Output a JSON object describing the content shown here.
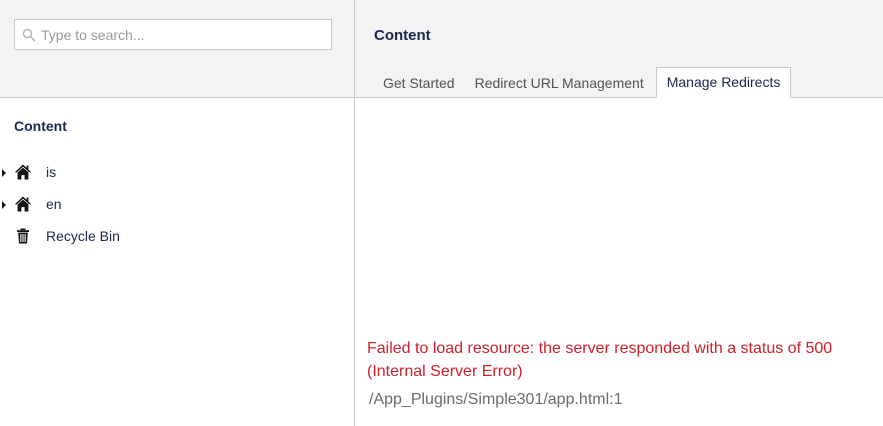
{
  "search": {
    "placeholder": "Type to search...",
    "value": "",
    "icon": "search-icon"
  },
  "tree": {
    "title": "Content",
    "items": [
      {
        "label": "is",
        "icon": "home-icon",
        "expandable": true
      },
      {
        "label": "en",
        "icon": "home-icon",
        "expandable": true
      },
      {
        "label": "Recycle Bin",
        "icon": "trash-icon",
        "expandable": false
      }
    ]
  },
  "main": {
    "title": "Content",
    "tabs": [
      {
        "label": "Get Started",
        "active": false
      },
      {
        "label": "Redirect URL Management",
        "active": false
      },
      {
        "label": "Manage Redirects",
        "active": true
      }
    ],
    "error_message": "Failed to load resource: the server responded with a status of 500 (Internal Server Error)",
    "error_path": "/App_Plugins/Simple301/app.html:1"
  },
  "colors": {
    "header_bg": "#f3f3f5",
    "border": "#c8c8c8",
    "text": "#1b264f",
    "error": "#d0202a",
    "muted": "#6b6b6b"
  }
}
